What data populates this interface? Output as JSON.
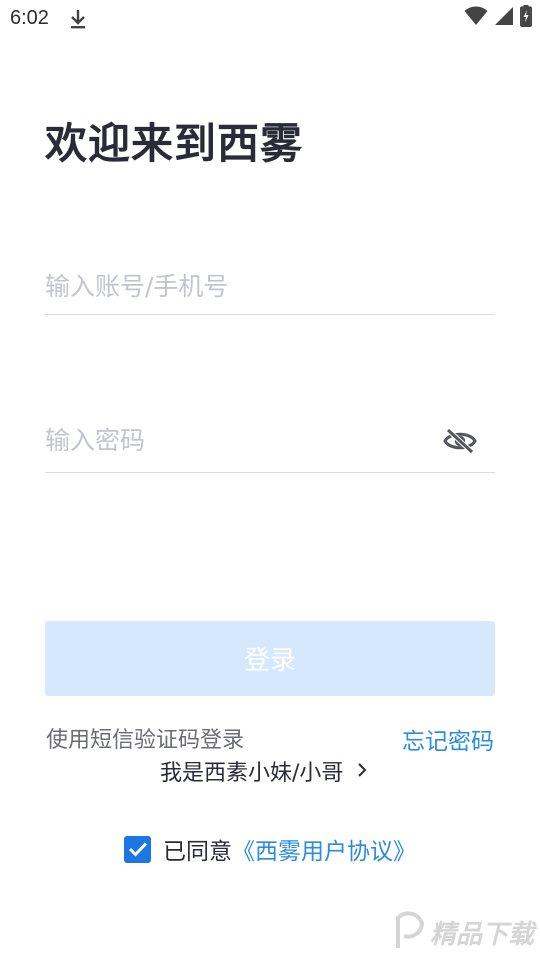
{
  "status_bar": {
    "time": "6:02",
    "icons": [
      "download-icon",
      "wifi-icon",
      "signal-icon",
      "battery-charging-icon"
    ]
  },
  "title": "欢迎来到西雾",
  "account_field": {
    "placeholder": "输入账号/手机号",
    "value": ""
  },
  "password_field": {
    "placeholder": "输入密码",
    "value": "",
    "toggle_icon": "eye-slash-icon"
  },
  "login_button": {
    "label": "登录"
  },
  "links": {
    "sms_login": "使用短信验证码登录",
    "forgot_password": "忘记密码",
    "role": "我是西素小妹/小哥"
  },
  "agreement": {
    "checked": true,
    "agree_label": "已同意",
    "link_text": "《西雾用户协议》"
  },
  "watermark": {
    "text": "精品下载"
  },
  "colors": {
    "accent": "#2a8ce0",
    "checkbox": "#1c76e3",
    "button_disabled_bg": "#d6e9fc",
    "title": "#2b2b38",
    "placeholder": "#c3c5cc"
  }
}
